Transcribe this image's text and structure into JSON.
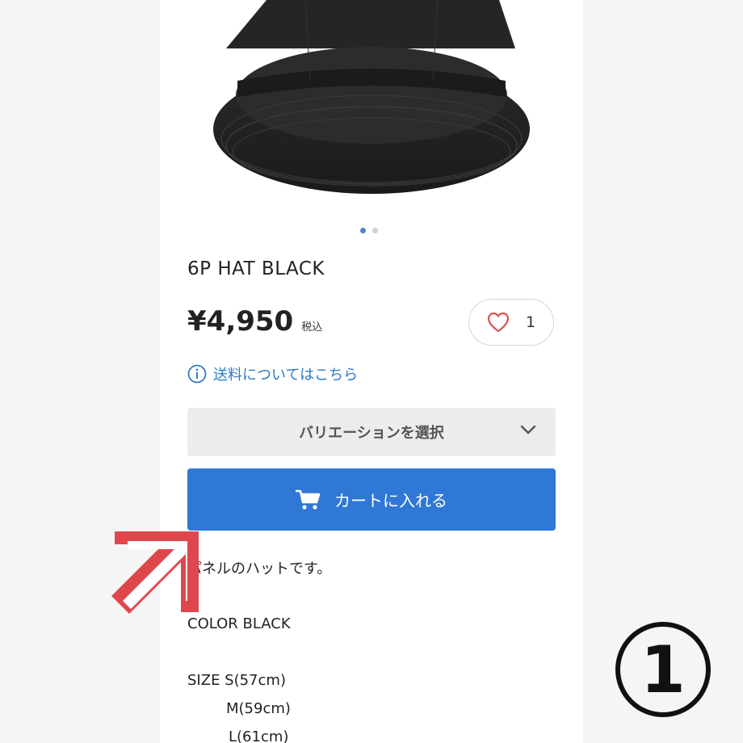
{
  "product": {
    "title": "6P HAT BLACK",
    "price": "¥4,950",
    "tax_label": "税込",
    "like_count": "1",
    "image_dots": {
      "total": 2,
      "active": 1
    }
  },
  "shipping": {
    "link_text": "送料についてはこちら"
  },
  "variation": {
    "label": "バリエーションを選択"
  },
  "cart": {
    "label": "カートに入れる"
  },
  "description": {
    "intro": "パネルのハットです。",
    "color": "COLOR BLACK",
    "size_s": "SIZE S(57cm)",
    "size_m": "M(59cm)",
    "size_l": "L(61cm)"
  },
  "overlay": {
    "step_number": "1"
  },
  "colors": {
    "accent_blue": "#2f78d6",
    "link_blue": "#2f7bcc",
    "arrow_red": "#e0474c",
    "heart": "#d9544f"
  }
}
